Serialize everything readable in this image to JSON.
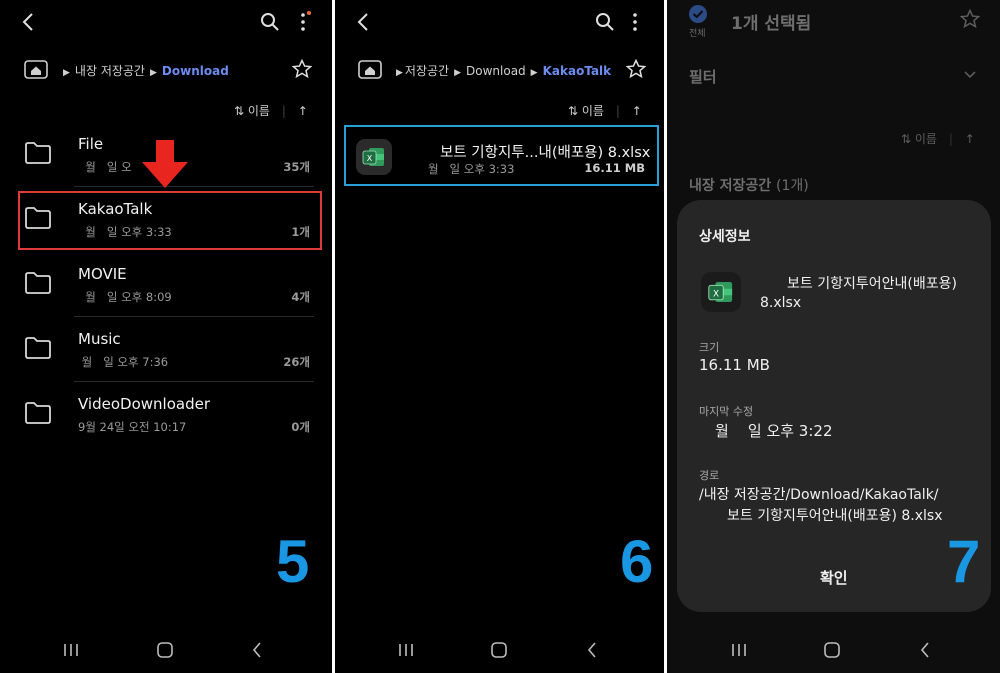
{
  "panel5": {
    "breadcrumb": [
      "내장 저장공간",
      "Download"
    ],
    "sort_label": "이름",
    "folders": [
      {
        "name": "File",
        "date": "  월   일 오",
        "count": "35개"
      },
      {
        "name": "KakaoTalk",
        "date": "  월   일 오후 3:33",
        "count": "1개"
      },
      {
        "name": "MOVIE",
        "date": "  월   일 오후 8:09",
        "count": "4개"
      },
      {
        "name": "Music",
        "date": " 월   일 오후 7:36",
        "count": "26개"
      },
      {
        "name": "VideoDownloader",
        "date": "9월 24일 오전 10:17",
        "count": "0개"
      }
    ],
    "step": "5"
  },
  "panel6": {
    "breadcrumb": [
      "저장공간",
      "Download",
      "KakaoTalk"
    ],
    "sort_label": "이름",
    "file": {
      "name": "보트 기항지투...내(배포용) 8.xlsx",
      "date": "월   일 오후 3:33",
      "size": "16.11 MB"
    },
    "step": "6"
  },
  "panel7": {
    "header_all": "전체",
    "header_title": "1개 선택됨",
    "filter_label": "필터",
    "sort_label": "이름",
    "storage_label": "내장 저장공간",
    "storage_count": "(1개)",
    "dialog": {
      "title": "상세정보",
      "file_name_line1": "보트 기항지투어안내(배포용)",
      "file_name_line2": "8.xlsx",
      "size_label": "크기",
      "size_value": "16.11 MB",
      "modified_label": "마지막 수정",
      "modified_value": "월    일 오후 3:22",
      "path_label": "경로",
      "path_line1": "/내장 저장공간/Download/KakaoTalk/",
      "path_line2": "보트 기항지투어안내(배포용) 8.xlsx",
      "confirm_label": "확인"
    },
    "step": "7"
  },
  "colors": {
    "accent_blue": "#6c8cf0",
    "step_number": "#1a97e2",
    "highlight_red": "#e03a3a",
    "highlight_blue": "#2a9fd6",
    "arrow_red": "#e8261f"
  }
}
